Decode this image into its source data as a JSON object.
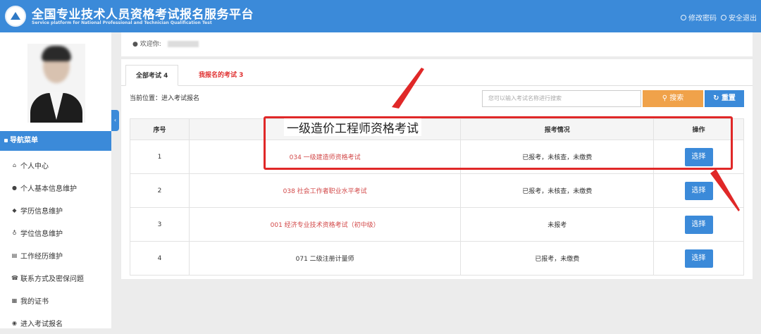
{
  "header": {
    "title": "全国专业技术人员资格考试报名服务平台",
    "subtitle": "Service platform for National Professional and Technician Qualification Test",
    "links": [
      "修改密码",
      "安全退出"
    ]
  },
  "sidebar": {
    "nav_title": "导航菜单",
    "items": [
      {
        "icon": "home-icon",
        "label": "个人中心"
      },
      {
        "icon": "user-icon",
        "label": "个人基本信息维护"
      },
      {
        "icon": "graduation-cap-icon",
        "label": "学历信息维护"
      },
      {
        "icon": "degree-icon",
        "label": "学位信息维护"
      },
      {
        "icon": "bank-icon",
        "label": "工作经历维护"
      },
      {
        "icon": "phone-icon",
        "label": "联系方式及密保问题"
      },
      {
        "icon": "certificate-icon",
        "label": "我的证书"
      },
      {
        "icon": "circle-icon",
        "label": "进入考试报名"
      }
    ]
  },
  "welcome": {
    "label": "欢迎你:"
  },
  "tabs": [
    {
      "label": "全部考试 4",
      "active": true
    },
    {
      "label": "我报名的考试 3",
      "active": false
    }
  ],
  "location": "当前位置：进入考试报名",
  "search": {
    "placeholder": "您可以输入考试名称进行搜索",
    "button": "搜索",
    "reset": "重置"
  },
  "table": {
    "headers": [
      "序号",
      "",
      "报考情况",
      "操作"
    ],
    "rows": [
      {
        "no": "1",
        "name": "034 一级建造师资格考试",
        "status": "已报考，未核查，未缴费",
        "action": "选择",
        "highlight": true
      },
      {
        "no": "2",
        "name": "038 社会工作者职业水平考试",
        "status": "已报考，未核查，未缴费",
        "action": "选择",
        "highlight": true
      },
      {
        "no": "3",
        "name": "001 经济专业技术资格考试（初中级）",
        "status": "未报考",
        "action": "选择",
        "highlight": true
      },
      {
        "no": "4",
        "name": "071 二级注册计量师",
        "status": "已报考，未缴费",
        "action": "选择",
        "highlight": false
      }
    ]
  },
  "annotation": {
    "label": "一级造价工程师资格考试",
    "color": "#e02828"
  },
  "colors": {
    "primary": "#3b8ad9",
    "search_button": "#f0a24a",
    "exam_name_red": "#d24848"
  }
}
